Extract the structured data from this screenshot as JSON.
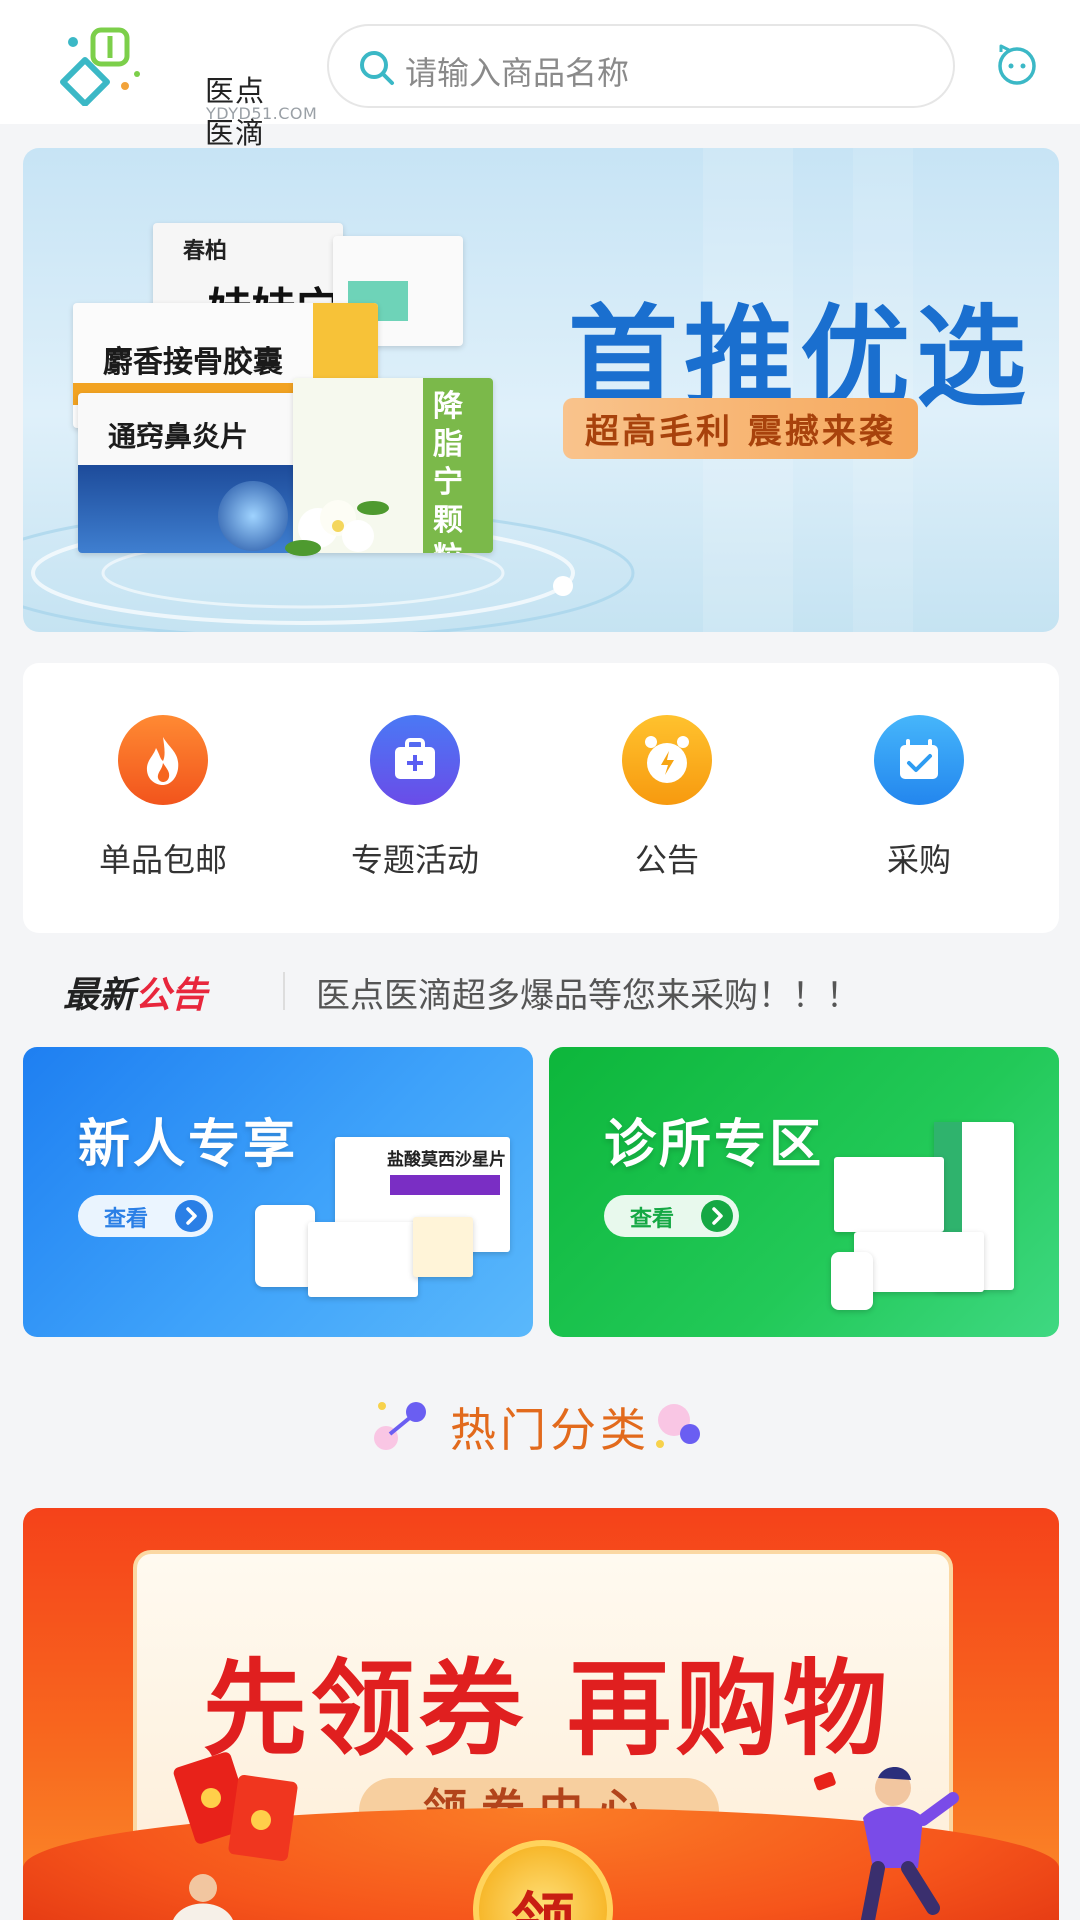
{
  "header": {
    "logo_name": "医点医滴",
    "logo_domain": "YDYD51.COM",
    "search_placeholder": "请输入商品名称",
    "accent_color": "#3bb8c6"
  },
  "hero": {
    "title": "首推优选",
    "subtitle": "超高毛利 震撼来袭",
    "products": [
      "春柏",
      "娃娃宁",
      "麝香接骨胶囊",
      "通窍鼻炎片",
      "降脂宁颗粒"
    ],
    "carousel_count": 1,
    "carousel_active": 1
  },
  "quick_menu": [
    {
      "label": "单品包邮",
      "icon": "flame-icon",
      "color": "#f6661f"
    },
    {
      "label": "专题活动",
      "icon": "medical-kit-icon",
      "color": "#5b5ef2"
    },
    {
      "label": "公告",
      "icon": "alarm-clock-icon",
      "color": "#f7a512"
    },
    {
      "label": "采购",
      "icon": "calendar-check-icon",
      "color": "#2e9cf2"
    }
  ],
  "notice": {
    "title_part1": "最新",
    "title_part2": "公告",
    "text": "医点医滴超多爆品等您来采购！！！"
  },
  "promo_cards": [
    {
      "title": "新人专享",
      "button": "查看",
      "product_label": "盐酸莫西沙星片",
      "color": "#2a87f2"
    },
    {
      "title": "诊所专区",
      "button": "查看",
      "color": "#1bbf4e"
    }
  ],
  "hot_categories": {
    "title": "热门分类"
  },
  "coupon_banner": {
    "title": "先领券 再购物",
    "subtitle": "领券中心",
    "coin_label": "领"
  }
}
